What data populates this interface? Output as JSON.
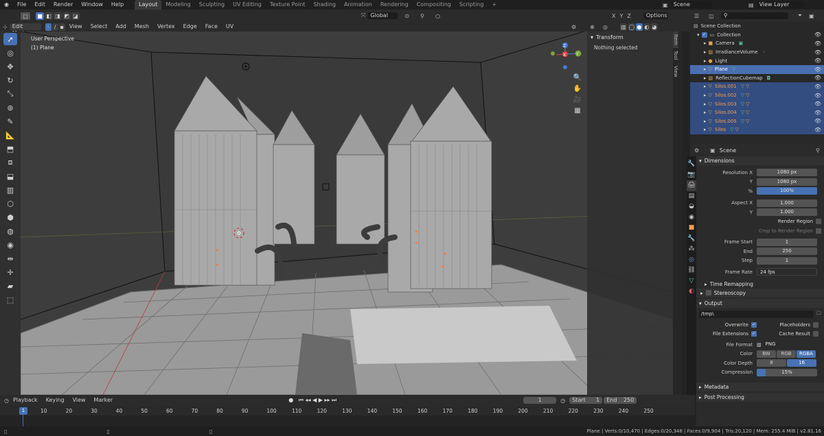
{
  "topbar": {
    "menus": [
      "File",
      "Edit",
      "Render",
      "Window",
      "Help"
    ],
    "workspaces": [
      "Layout",
      "Modeling",
      "Sculpting",
      "UV Editing",
      "Texture Point",
      "Shading",
      "Animation",
      "Rendering",
      "Compositing",
      "Scripting"
    ],
    "active_workspace": "Layout",
    "plus": "+",
    "scene": "Scene",
    "view_layer": "View Layer"
  },
  "tool_header": {
    "transform_orientation": "Global",
    "axes": [
      "X",
      "Y",
      "Z"
    ],
    "options": "Options"
  },
  "viewport_header": {
    "mode": "Edit Mode",
    "menus": [
      "View",
      "Select",
      "Add",
      "Mesh",
      "Vertex",
      "Edge",
      "Face",
      "UV"
    ]
  },
  "viewport": {
    "perspective_label": "User Perspective",
    "object_label": "(1) Plane",
    "gizmo": {
      "x": "X",
      "y": "Y",
      "z": "Z"
    }
  },
  "npanel": {
    "title": "Transform",
    "message": "Nothing selected",
    "tabs": [
      "Item",
      "Tool",
      "View"
    ]
  },
  "outliner": {
    "search_placeholder": "",
    "root": "Scene Collection",
    "collection": "Collection",
    "items": [
      {
        "name": "Camera",
        "selected": false
      },
      {
        "name": "IrradianceVolume",
        "selected": false
      },
      {
        "name": "Light",
        "selected": false
      },
      {
        "name": "Plane",
        "selected": true,
        "active": true
      },
      {
        "name": "ReflectionCubemap",
        "selected": false
      },
      {
        "name": "Silos.001",
        "selected": true
      },
      {
        "name": "Silos.002",
        "selected": true
      },
      {
        "name": "Silos.003",
        "selected": true
      },
      {
        "name": "Silos.004",
        "selected": true
      },
      {
        "name": "Silos.005",
        "selected": true
      },
      {
        "name": "Silos",
        "selected": true
      }
    ]
  },
  "properties": {
    "context": "Scene",
    "dimensions": {
      "title": "Dimensions",
      "res_x_label": "Resolution X",
      "res_x": "1080 px",
      "res_y_label": "Y",
      "res_y": "1080 px",
      "pct_label": "%",
      "pct": "100%",
      "aspect_x_label": "Aspect X",
      "aspect_x": "1.000",
      "aspect_y_label": "Y",
      "aspect_y": "1.000",
      "render_region": "Render Region",
      "crop": "Crop to Render Region",
      "frame_start_label": "Frame Start",
      "frame_start": "1",
      "end_label": "End",
      "end": "250",
      "step_label": "Step",
      "step": "1",
      "frame_rate_label": "Frame Rate",
      "frame_rate": "24 fps"
    },
    "time_remapping": "Time Remapping",
    "stereoscopy": "Stereoscopy",
    "output": {
      "title": "Output",
      "path": "/tmp\\",
      "overwrite": "Overwrite",
      "placeholders": "Placeholders",
      "file_extensions": "File Extensions",
      "cache_result": "Cache Result",
      "file_format_label": "File Format",
      "file_format": "PNG",
      "color_label": "Color",
      "color_options": [
        "BW",
        "RGB",
        "RGBA"
      ],
      "color_selected": "RGBA",
      "depth_label": "Color Depth",
      "depth_options": [
        "8",
        "16"
      ],
      "depth_selected": "16",
      "compression_label": "Compression",
      "compression": "15%",
      "compression_fraction": 0.15
    },
    "metadata": "Metadata",
    "post_processing": "Post Processing"
  },
  "timeline": {
    "menus": [
      "Playback",
      "Keying",
      "View",
      "Marker"
    ],
    "current_frame": "1",
    "start_label": "Start",
    "start": "1",
    "end_label": "End",
    "end": "250",
    "ticks": [
      "1",
      "10",
      "20",
      "30",
      "40",
      "50",
      "60",
      "70",
      "80",
      "90",
      "100",
      "110",
      "120",
      "130",
      "140",
      "150",
      "160",
      "170",
      "180",
      "190",
      "200",
      "210",
      "220",
      "230",
      "240",
      "250"
    ]
  },
  "statusbar": {
    "stats": "Plane | Verts:0/10,470 | Edges:0/20,348 | Faces:0/9,904 | Tris:20,120 | Mem: 255.4 MiB | v2.81.16"
  },
  "colors": {
    "accent": "#4772b3",
    "selected_row": "#334d80",
    "selected_name": "#f59c52",
    "viewport_bg": "#3d3d3d"
  }
}
